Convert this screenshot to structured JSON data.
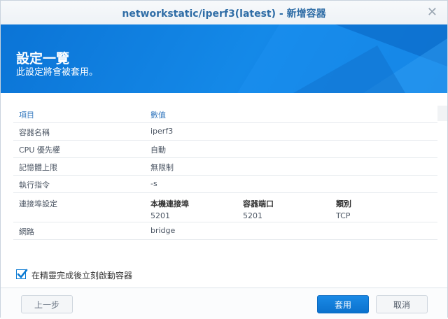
{
  "window": {
    "title": "networkstatic/iperf3(latest) - 新增容器"
  },
  "banner": {
    "title": "設定一覽",
    "subtitle": "此設定將會被套用。"
  },
  "table": {
    "headers": [
      "項目",
      "數值"
    ],
    "rows": [
      {
        "label": "容器名稱",
        "value": "iperf3"
      },
      {
        "label": "CPU 優先權",
        "value": "自動"
      },
      {
        "label": "記憶體上限",
        "value": "無限制"
      },
      {
        "label": "執行指令",
        "value": "-s"
      }
    ],
    "ports": {
      "label": "連接埠設定",
      "headers": [
        "本機連接埠",
        "容器端口",
        "類別"
      ],
      "values": [
        "5201",
        "5201",
        "TCP"
      ]
    },
    "network": {
      "label": "網路",
      "value": "bridge"
    }
  },
  "option": {
    "run_after_wizard": "在精靈完成後立刻啟動容器",
    "checked": true
  },
  "footer": {
    "back": "上一步",
    "apply": "套用",
    "cancel": "取消"
  },
  "colors": {
    "accent": "#0b74d6",
    "link": "#3a7cc0"
  }
}
